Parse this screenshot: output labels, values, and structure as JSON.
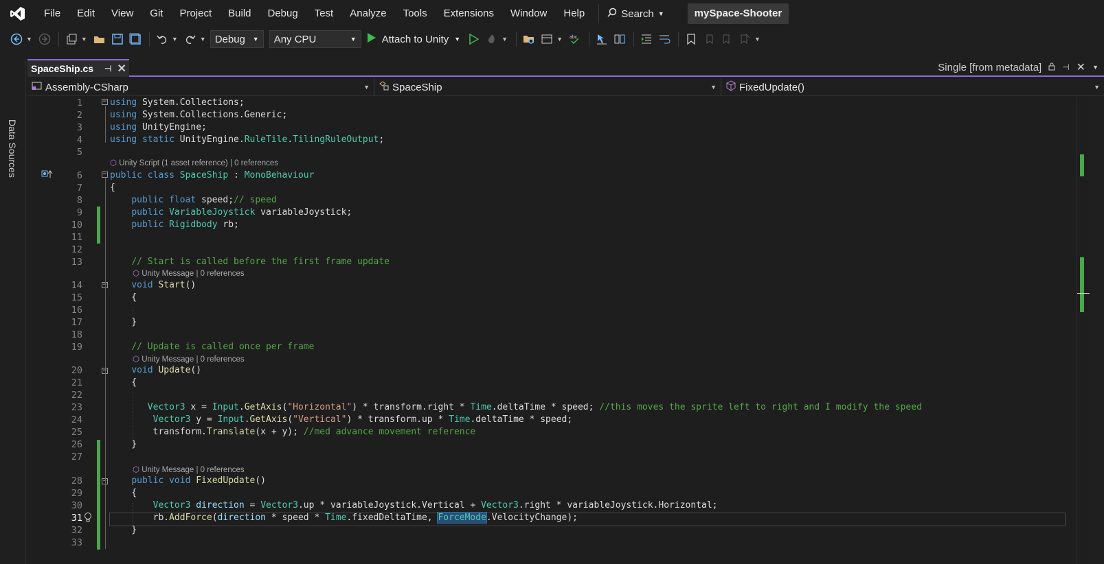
{
  "menu": {
    "items": [
      "File",
      "Edit",
      "View",
      "Git",
      "Project",
      "Build",
      "Debug",
      "Test",
      "Analyze",
      "Tools",
      "Extensions",
      "Window",
      "Help"
    ],
    "search_label": "Search",
    "solution_name": "mySpace-Shooter"
  },
  "toolbar": {
    "configuration": "Debug",
    "platform": "Any CPU",
    "attach_label": "Attach to Unity"
  },
  "side_panel": {
    "tab_label": "Data Sources"
  },
  "tabs": {
    "active_file": "SpaceShip.cs",
    "metadata_label": "Single [from metadata]"
  },
  "navbar": {
    "project": "Assembly-CSharp",
    "type": "SpaceShip",
    "member": "FixedUpdate()"
  },
  "code_lens": {
    "class": "Unity Script (1 asset reference) | 0 references",
    "start": "Unity Message | 0 references",
    "update": "Unity Message | 0 references",
    "fixed_update": "Unity Message | 0 references"
  },
  "code_lines": [
    {
      "n": "1",
      "tokens": [
        [
          "k",
          "using"
        ],
        [
          "p",
          " System.Collections;"
        ]
      ]
    },
    {
      "n": "2",
      "tokens": [
        [
          "k",
          "using"
        ],
        [
          "p",
          " System.Collections.Generic;"
        ]
      ]
    },
    {
      "n": "3",
      "tokens": [
        [
          "k",
          "using"
        ],
        [
          "p",
          " UnityEngine;"
        ]
      ]
    },
    {
      "n": "4",
      "tokens": [
        [
          "k",
          "using"
        ],
        [
          "p",
          " "
        ],
        [
          "k",
          "static"
        ],
        [
          "p",
          " UnityEngine."
        ],
        [
          "t",
          "RuleTile"
        ],
        [
          "p",
          "."
        ],
        [
          "t",
          "TilingRuleOutput"
        ],
        [
          "p",
          ";"
        ]
      ]
    },
    {
      "n": "5",
      "tokens": []
    },
    {
      "n": "6",
      "tokens": [
        [
          "k",
          "public class"
        ],
        [
          "p",
          " "
        ],
        [
          "t",
          "SpaceShip"
        ],
        [
          "p",
          " : "
        ],
        [
          "t",
          "MonoBehaviour"
        ]
      ]
    },
    {
      "n": "7",
      "tokens": [
        [
          "p",
          "{"
        ]
      ]
    },
    {
      "n": "8",
      "tokens": [
        [
          "p",
          "    "
        ],
        [
          "k",
          "public float"
        ],
        [
          "p",
          " speed;"
        ],
        [
          "c",
          "// speed"
        ]
      ]
    },
    {
      "n": "9",
      "tokens": [
        [
          "p",
          "    "
        ],
        [
          "k",
          "public"
        ],
        [
          "p",
          " "
        ],
        [
          "t",
          "VariableJoystick"
        ],
        [
          "p",
          " variableJoystick;"
        ]
      ]
    },
    {
      "n": "10",
      "tokens": [
        [
          "p",
          "    "
        ],
        [
          "k",
          "public"
        ],
        [
          "p",
          " "
        ],
        [
          "t",
          "Rigidbody"
        ],
        [
          "p",
          " rb;"
        ]
      ]
    },
    {
      "n": "11",
      "tokens": []
    },
    {
      "n": "12",
      "tokens": []
    },
    {
      "n": "13",
      "tokens": [
        [
          "p",
          "    "
        ],
        [
          "c",
          "// Start is called before the first frame update"
        ]
      ]
    },
    {
      "n": "14",
      "tokens": [
        [
          "p",
          "    "
        ],
        [
          "k",
          "void"
        ],
        [
          "p",
          " "
        ],
        [
          "m",
          "Start"
        ],
        [
          "p",
          "()"
        ]
      ]
    },
    {
      "n": "15",
      "tokens": [
        [
          "p",
          "    {"
        ]
      ]
    },
    {
      "n": "16",
      "tokens": []
    },
    {
      "n": "17",
      "tokens": [
        [
          "p",
          "    }"
        ]
      ]
    },
    {
      "n": "18",
      "tokens": []
    },
    {
      "n": "19",
      "tokens": [
        [
          "p",
          "    "
        ],
        [
          "c",
          "// Update is called once per frame"
        ]
      ]
    },
    {
      "n": "20",
      "tokens": [
        [
          "p",
          "    "
        ],
        [
          "k",
          "void"
        ],
        [
          "p",
          " "
        ],
        [
          "m",
          "Update"
        ],
        [
          "p",
          "()"
        ]
      ]
    },
    {
      "n": "21",
      "tokens": [
        [
          "p",
          "    {"
        ]
      ]
    },
    {
      "n": "22",
      "tokens": []
    },
    {
      "n": "23",
      "tokens": [
        [
          "p",
          "       "
        ],
        [
          "t",
          "Vector3"
        ],
        [
          "p",
          " x = "
        ],
        [
          "t",
          "Input"
        ],
        [
          "p",
          "."
        ],
        [
          "m",
          "GetAxis"
        ],
        [
          "p",
          "("
        ],
        [
          "s",
          "\"Horizontal\""
        ],
        [
          "p",
          ") * transform.right * "
        ],
        [
          "t",
          "Time"
        ],
        [
          "p",
          ".deltaTime * speed; "
        ],
        [
          "c",
          "//this moves the sprite left to right and I modify the speed"
        ]
      ]
    },
    {
      "n": "24",
      "tokens": [
        [
          "p",
          "        "
        ],
        [
          "t",
          "Vector3"
        ],
        [
          "p",
          " y = "
        ],
        [
          "t",
          "Input"
        ],
        [
          "p",
          "."
        ],
        [
          "m",
          "GetAxis"
        ],
        [
          "p",
          "("
        ],
        [
          "s",
          "\"Vertical\""
        ],
        [
          "p",
          ") * transform.up * "
        ],
        [
          "t",
          "Time"
        ],
        [
          "p",
          ".deltaTime * speed;"
        ]
      ]
    },
    {
      "n": "25",
      "tokens": [
        [
          "p",
          "        transform."
        ],
        [
          "m",
          "Translate"
        ],
        [
          "p",
          "(x + y); "
        ],
        [
          "c",
          "//med advance movement reference"
        ]
      ]
    },
    {
      "n": "26",
      "tokens": [
        [
          "p",
          "    }"
        ]
      ]
    },
    {
      "n": "27",
      "tokens": []
    },
    {
      "n": "28",
      "tokens": [
        [
          "p",
          "    "
        ],
        [
          "k",
          "public void"
        ],
        [
          "p",
          " "
        ],
        [
          "m",
          "FixedUpdate"
        ],
        [
          "p",
          "()"
        ]
      ]
    },
    {
      "n": "29",
      "tokens": [
        [
          "p",
          "    {"
        ]
      ]
    },
    {
      "n": "30",
      "tokens": [
        [
          "p",
          "        "
        ],
        [
          "t",
          "Vector3"
        ],
        [
          "p",
          " "
        ],
        [
          "v",
          "direction"
        ],
        [
          "p",
          " = "
        ],
        [
          "t",
          "Vector3"
        ],
        [
          "p",
          ".up * variableJoystick.Vertical + "
        ],
        [
          "t",
          "Vector3"
        ],
        [
          "p",
          ".right * variableJoystick.Horizontal;"
        ]
      ]
    },
    {
      "n": "31",
      "tokens": [
        [
          "p",
          "        rb."
        ],
        [
          "m",
          "AddForce"
        ],
        [
          "p",
          "("
        ],
        [
          "v",
          "direction"
        ],
        [
          "p",
          " * speed * "
        ],
        [
          "t",
          "Time"
        ],
        [
          "p",
          ".fixedDeltaTime, "
        ],
        [
          "sel",
          "ForceMode"
        ],
        [
          "p",
          ".VelocityChange);"
        ]
      ]
    },
    {
      "n": "32",
      "tokens": [
        [
          "p",
          "    }"
        ]
      ]
    },
    {
      "n": "33",
      "tokens": []
    }
  ],
  "colors": {
    "accent": "#8c6cdb",
    "keyword": "#569cd6",
    "type": "#4ec9b0",
    "comment": "#57a64a",
    "string": "#d69d85",
    "method": "#dcdcaa",
    "changed": "#4ca64c"
  }
}
